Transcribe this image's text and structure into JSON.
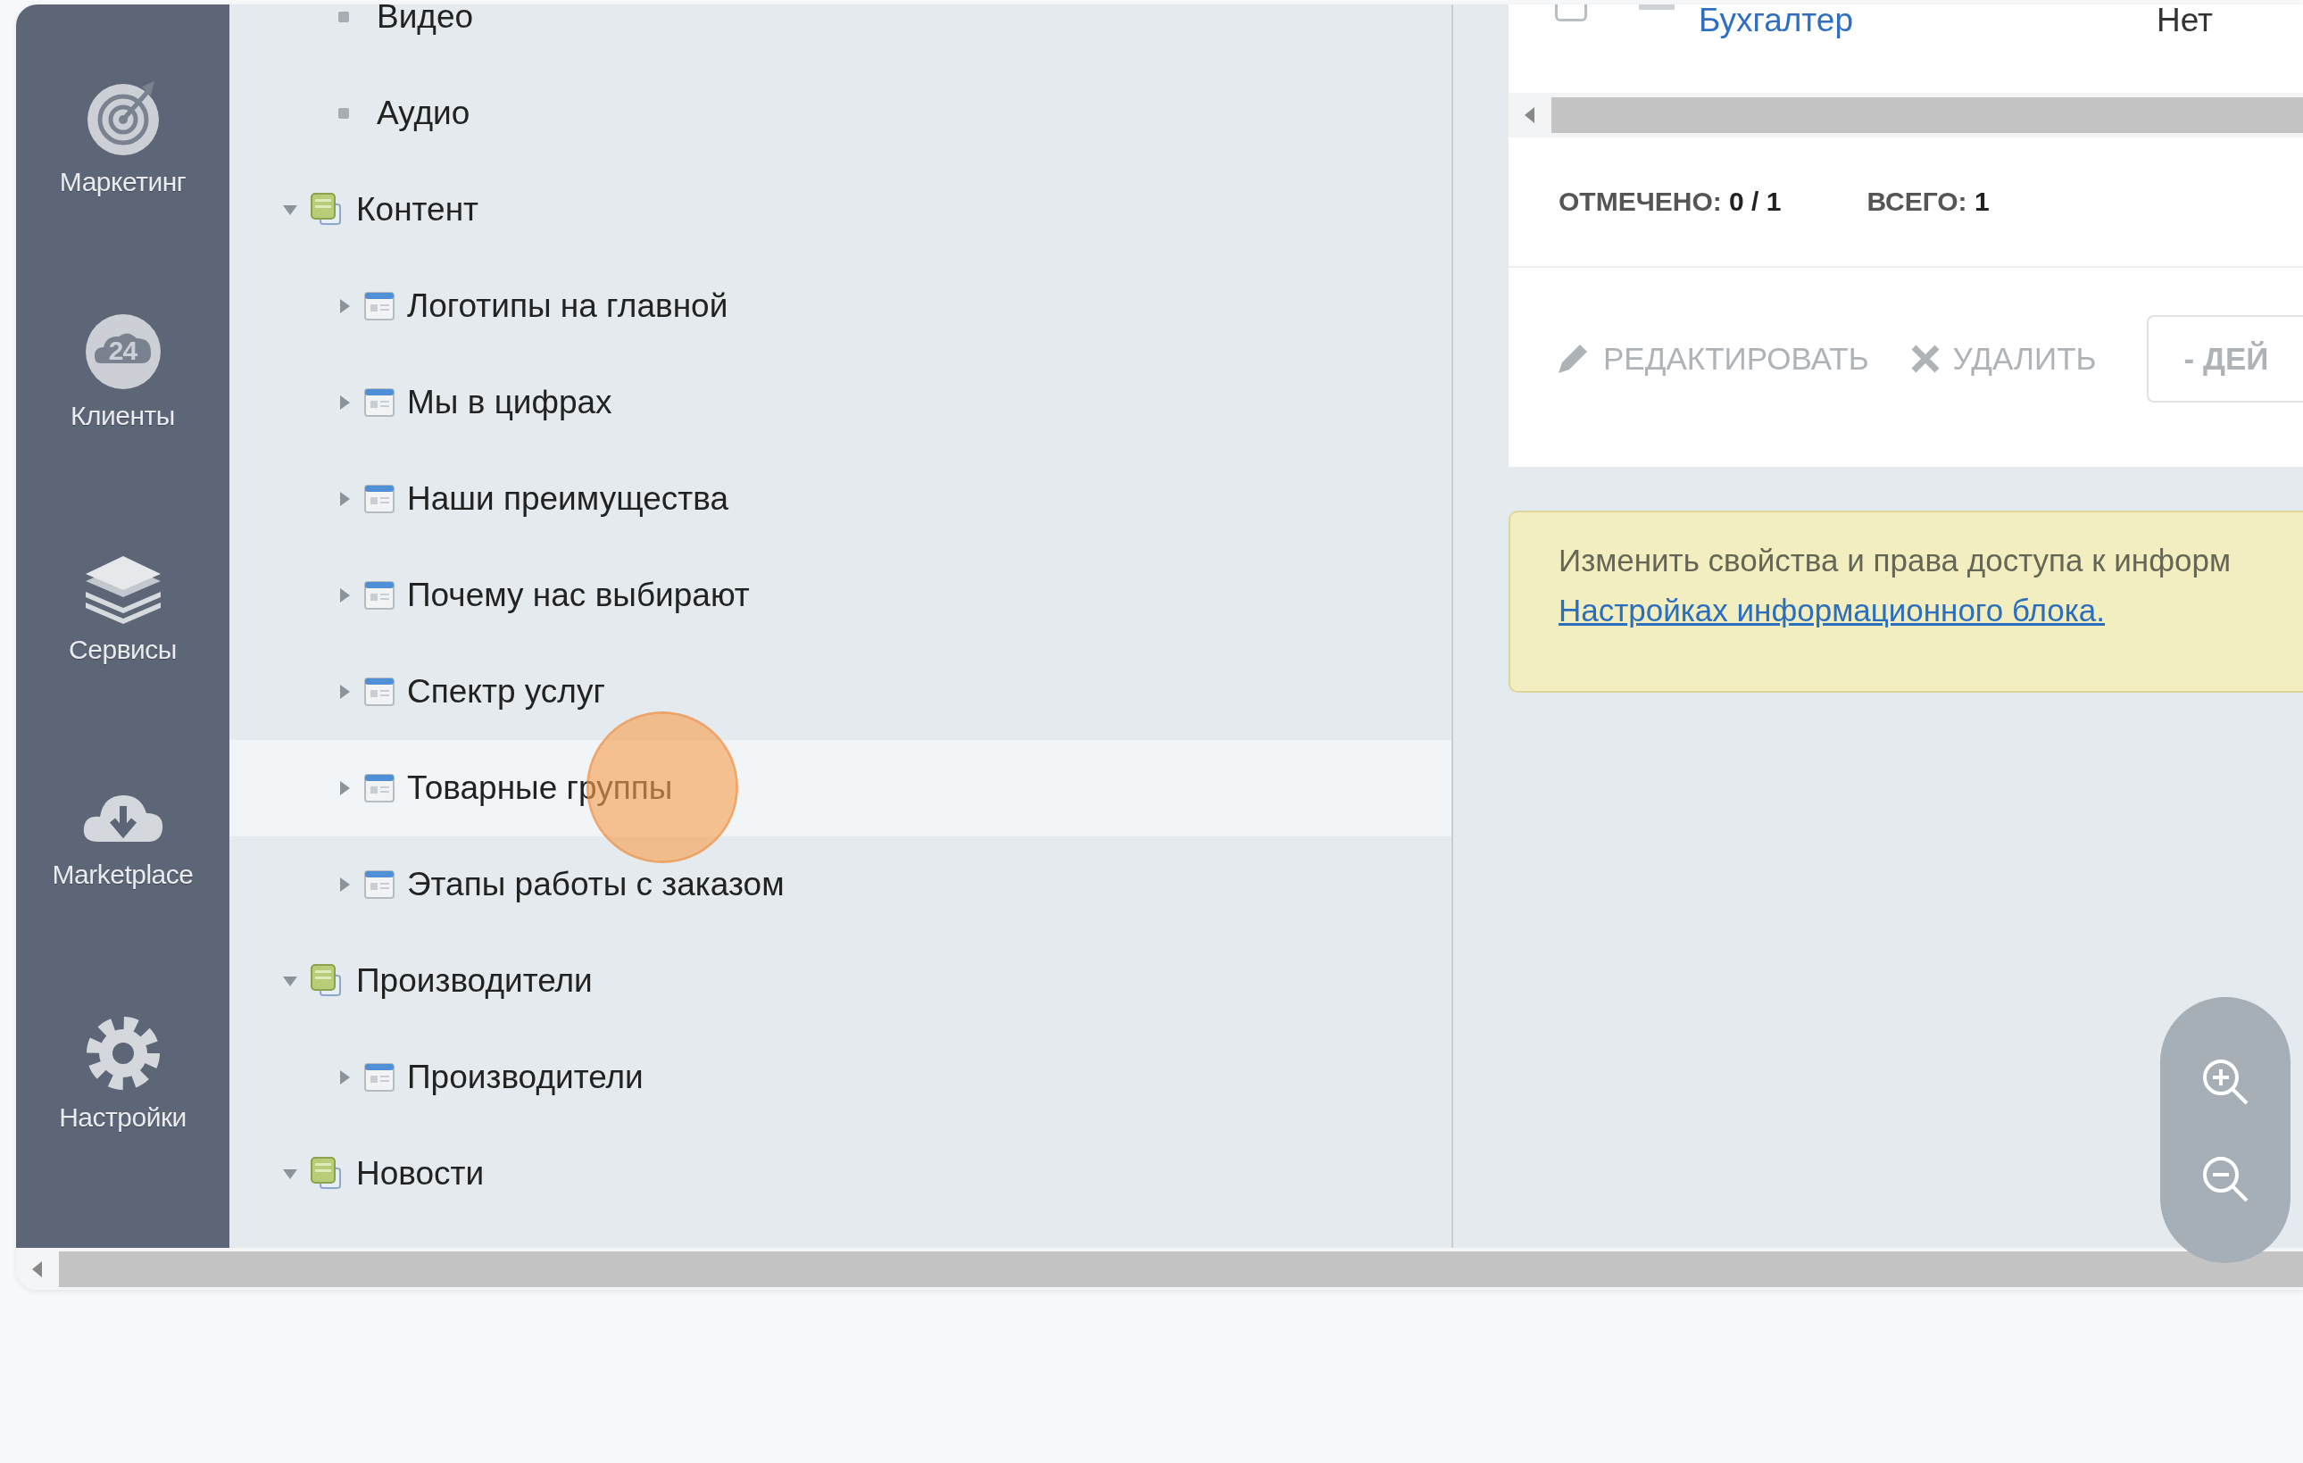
{
  "sidebar": {
    "items": [
      {
        "label": "Маркетинг"
      },
      {
        "label": "Клиенты",
        "icon_text": "24"
      },
      {
        "label": "Сервисы"
      },
      {
        "label": "Marketplace"
      },
      {
        "label": "Настройки"
      }
    ]
  },
  "tree": {
    "items": [
      {
        "kind": "leaf",
        "label": "Видео",
        "selected": false
      },
      {
        "kind": "leaf",
        "label": "Аудио",
        "selected": false
      },
      {
        "kind": "section",
        "label": "Контент",
        "expanded": true,
        "selected": false,
        "children": [
          {
            "kind": "block",
            "label": "Логотипы на главной",
            "expanded": false,
            "selected": false
          },
          {
            "kind": "block",
            "label": "Мы в цифрах",
            "expanded": false,
            "selected": false
          },
          {
            "kind": "block",
            "label": "Наши преимущества",
            "expanded": false,
            "selected": false
          },
          {
            "kind": "block",
            "label": "Почему нас выбирают",
            "expanded": false,
            "selected": false
          },
          {
            "kind": "block",
            "label": "Спектр услуг",
            "expanded": false,
            "selected": false
          },
          {
            "kind": "block",
            "label": "Товарные группы",
            "expanded": false,
            "selected": true
          },
          {
            "kind": "block",
            "label": "Этапы работы с заказом",
            "expanded": false,
            "selected": false
          }
        ]
      },
      {
        "kind": "section",
        "label": "Производители",
        "expanded": true,
        "selected": false,
        "children": [
          {
            "kind": "block",
            "label": "Производители",
            "expanded": false,
            "selected": false
          }
        ]
      },
      {
        "kind": "section",
        "label": "Новости",
        "expanded": true,
        "selected": false
      }
    ]
  },
  "grid": {
    "row": {
      "checked": false,
      "name": "Бухгалтер",
      "column_3": "Нет"
    },
    "counters": [
      {
        "label": "ОТМЕЧЕНО:",
        "value": "0 / 1"
      },
      {
        "label": "ВСЕГО:",
        "value": "1"
      }
    ],
    "actions": [
      {
        "label": "РЕДАКТИРОВАТЬ",
        "disabled": true
      },
      {
        "label": "УДАЛИТЬ",
        "disabled": true
      }
    ],
    "action_select": {
      "value": "- ДЕЙ"
    }
  },
  "notice": {
    "text": "Изменить свойства и права доступа к информ",
    "link": "Настройках информационного блока."
  }
}
